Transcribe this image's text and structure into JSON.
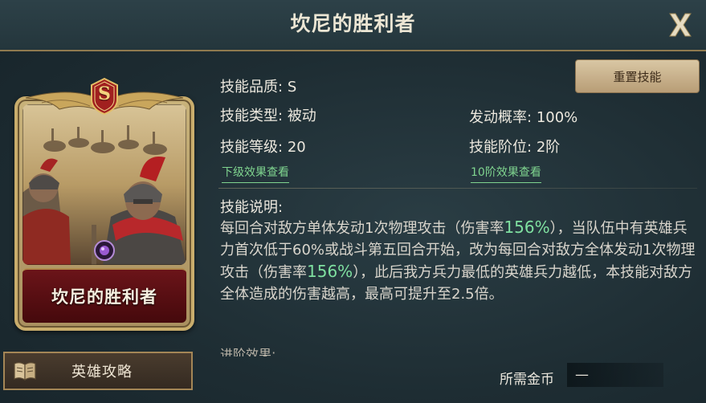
{
  "header": {
    "title": "坎尼的胜利者",
    "close_label": "X"
  },
  "card": {
    "rank": "S",
    "name": "坎尼的胜利者"
  },
  "buttons": {
    "reset_skill": "重置技能",
    "hero_guide": "英雄攻略"
  },
  "attributes": {
    "quality_label": "技能品质:",
    "quality_value": "S",
    "type_label": "技能类型:",
    "type_value": "被动",
    "level_label": "技能等级:",
    "level_value": "20",
    "chance_label": "发动概率:",
    "chance_value": "100%",
    "tier_label": "技能阶位:",
    "tier_value": "2阶"
  },
  "links": {
    "next_level": "下级效果查看",
    "tier10": "10阶效果查看"
  },
  "description": {
    "title": "技能说明:",
    "part1": "每回合对敌方单体发动1次物理攻击（伤害率",
    "rate1": "156%",
    "part2": "），当队伍中有英雄兵力首次低于60%或战斗第五回合开始，改为每回合对敌方全体发动1次物理攻击（伤害率",
    "rate2": "156%",
    "part3": "），此后我方兵力最低的英雄兵力越低，本技能对敌方全体造成的伤害越高，最高可提升至2.5倍。"
  },
  "advanced_title": "进阶效果:",
  "cost": {
    "label": "所需金币",
    "value": "—"
  },
  "colors": {
    "highlight": "#7fe0a0",
    "link": "#7fd48f",
    "gold_border": "#c9ad6c",
    "nameplate": "#6b1419"
  },
  "icons": {
    "close": "close-x-icon",
    "guide": "book-icon",
    "gem": "purple-gem-icon",
    "rank": "wing-crest-icon"
  }
}
